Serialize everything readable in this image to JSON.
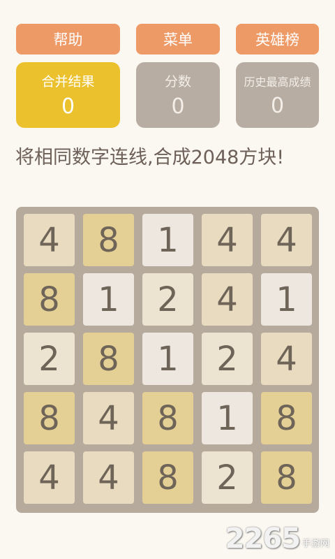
{
  "header": {
    "help_label": "帮助",
    "menu_label": "菜单",
    "leaderboard_label": "英雄榜"
  },
  "stats": {
    "merge": {
      "label": "合并结果",
      "value": "0"
    },
    "score": {
      "label": "分数",
      "value": "0"
    },
    "best": {
      "label": "历史最高成绩",
      "value": "0"
    }
  },
  "instruction": "将相同数字连线,合成2048方块!",
  "board": {
    "rows": [
      [
        "4",
        "8",
        "1",
        "4",
        "4"
      ],
      [
        "8",
        "1",
        "2",
        "4",
        "1"
      ],
      [
        "2",
        "8",
        "1",
        "2",
        "4"
      ],
      [
        "8",
        "4",
        "8",
        "1",
        "8"
      ],
      [
        "4",
        "4",
        "8",
        "2",
        "8"
      ]
    ]
  },
  "tile_colors": {
    "1": "#ede7e0",
    "2": "#ece3d0",
    "4": "#e8dbc0",
    "8": "#e4d095"
  },
  "watermark": {
    "brand": "2265",
    "site": "手游网"
  }
}
